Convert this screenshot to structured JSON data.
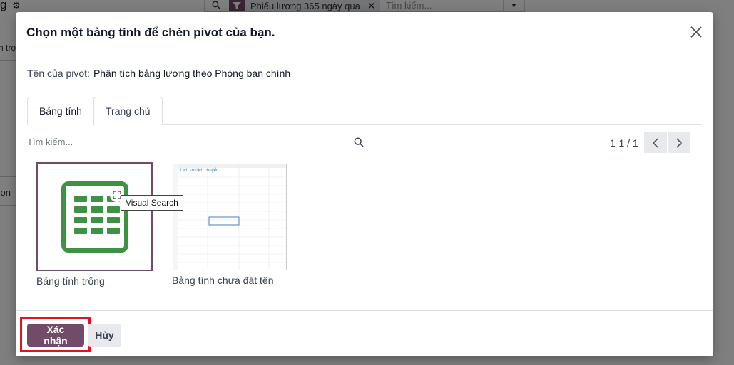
{
  "background": {
    "header_fragment": "g",
    "search_facet": "Phiếu lương 365 ngày qua",
    "search_placeholder": "Tìm kiếm...",
    "left_fragment_1": "n trọ",
    "left_fragment_2": "tion"
  },
  "dialog": {
    "title": "Chọn một bảng tính để chèn pivot của bạn.",
    "name_label": "Tên của pivot:",
    "name_value": "Phân tích bảng lương theo Phòng ban chính",
    "tabs": [
      {
        "label": "Bảng tính",
        "active": true
      },
      {
        "label": "Trang chủ",
        "active": false
      }
    ],
    "search": {
      "placeholder": "Tìm kiếm...",
      "value": ""
    },
    "pager": {
      "value": "1-1 / 1"
    },
    "cards": [
      {
        "label": "Bảng tính trống",
        "selected": true
      },
      {
        "label": "Bảng tính chưa đặt tên",
        "preview_title": "Lịch sử dịch chuyển"
      }
    ],
    "tooltip": "Visual Search",
    "footer": {
      "confirm_label": "Xác nhận",
      "cancel_label": "Hủy"
    }
  },
  "colors": {
    "primary": "#714B67",
    "sheet_green": "#3f9144",
    "highlight_red": "#e0141e",
    "secondary_btn": "#e7e9ed"
  },
  "icons": {
    "close": "close-icon",
    "search": "search-icon",
    "prev": "chevron-left-icon",
    "next": "chevron-right-icon",
    "expand": "expand-icon",
    "filter": "filter-icon",
    "gear": "gear-icon"
  }
}
